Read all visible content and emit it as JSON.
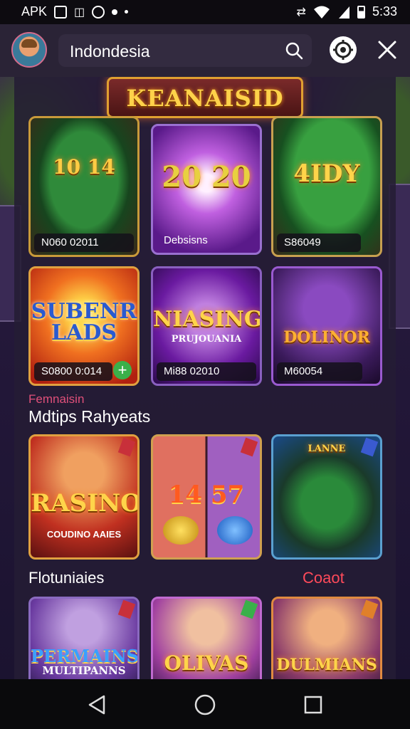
{
  "status_bar": {
    "left_text": "APK",
    "time": "5:33",
    "icons": [
      "image-icon",
      "android-icon",
      "chat-icon",
      "dot-icon",
      "small-dot-icon",
      "vibrate-icon",
      "wifi-icon",
      "battery-icon"
    ]
  },
  "top_bar": {
    "search_value": "Indondesia",
    "icons": [
      "avatar",
      "search-icon",
      "gear-icon",
      "close-icon"
    ]
  },
  "banner": {
    "title": "KEANAISID"
  },
  "grid_top": [
    {
      "big": "10  14",
      "caption": "N060 02011"
    },
    {
      "big": "20 20",
      "caption": "Debsisns"
    },
    {
      "big": "4IDY",
      "caption": "S86049"
    },
    {
      "big": "SUBENR LADS",
      "caption": "S0800 0:014"
    },
    {
      "big": "NIASING",
      "subtitle": "PRUJOUANIA",
      "caption": "Mi88 02010"
    },
    {
      "big": "DOLINOR",
      "caption": "M60054"
    }
  ],
  "section1": {
    "subtitle": "Femnaisin",
    "title": "Mdtips Rahyeats"
  },
  "grid_mid": [
    {
      "big": "RASINO",
      "subtitle": "COUDINO AAIES"
    },
    {
      "big": "14  57"
    },
    {
      "big": "LANNE"
    }
  ],
  "section2": {
    "title": "Flotuniaies",
    "link": "Coaot"
  },
  "grid_bottom": [
    {
      "big": "PERMAINS",
      "subtitle": "MULTIPANNS"
    },
    {
      "big": "OLIVAS"
    },
    {
      "big": "DULMIANS"
    }
  ],
  "colors": {
    "accent_gold": "#ffd44a",
    "accent_red": "#e0507a",
    "link_red": "#ff4a5a",
    "panel_bg": "#241c34"
  }
}
